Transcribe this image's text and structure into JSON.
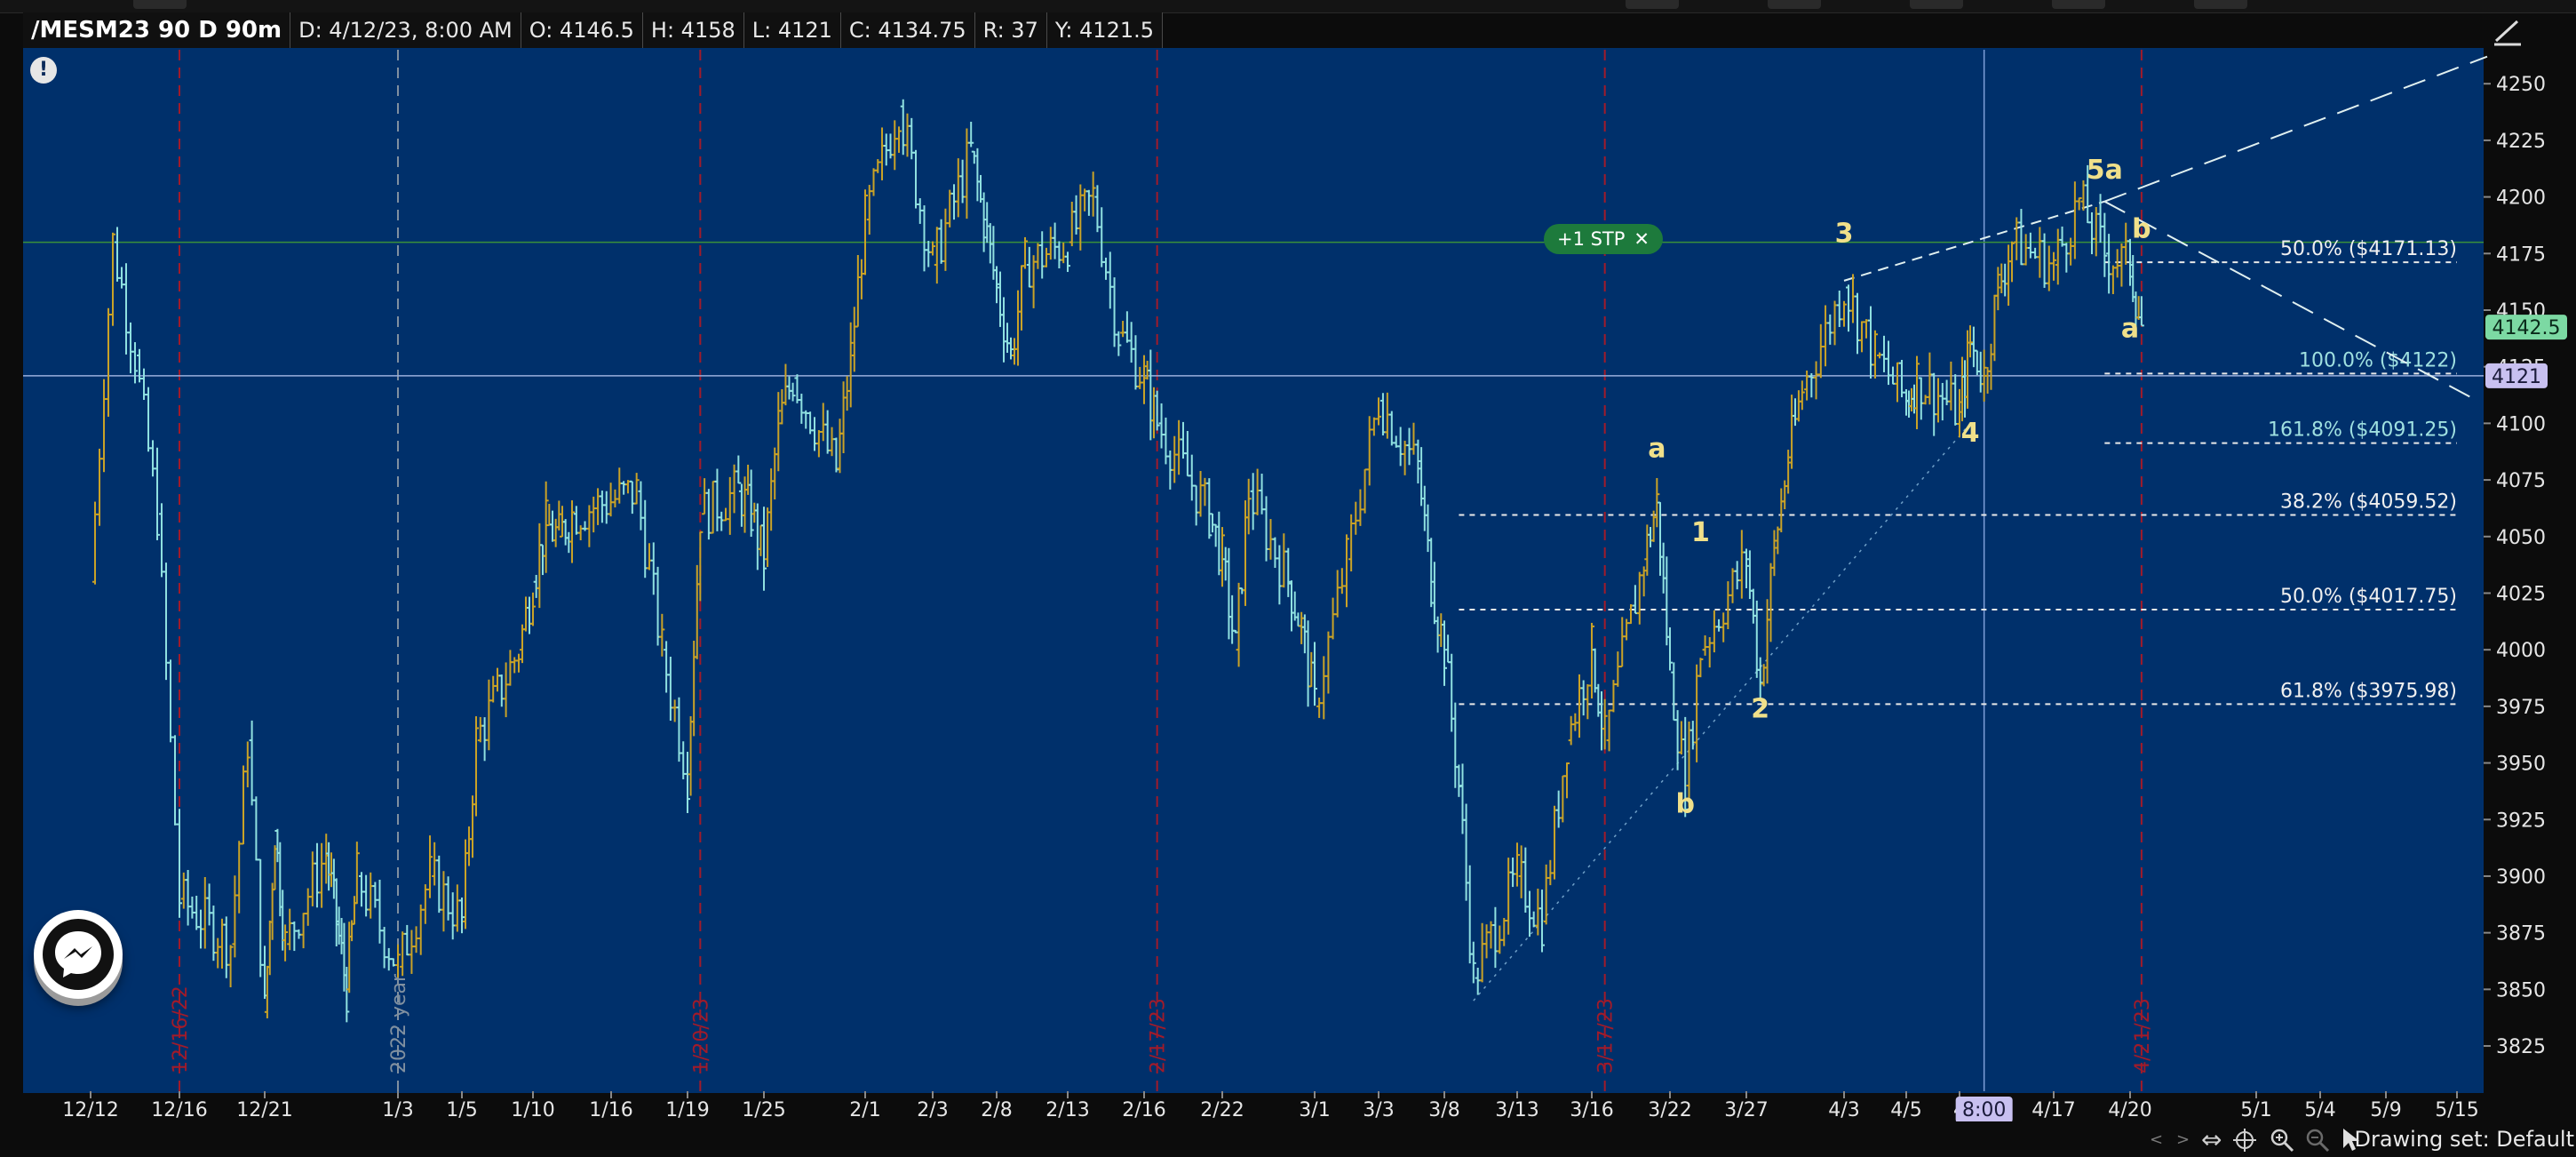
{
  "header": {
    "symbol": "/MESM23 90 D 90m",
    "date": "D: 4/12/23, 8:00 AM",
    "open": "O: 4146.5",
    "high": "H: 4158",
    "low": "L: 4121",
    "close": "C: 4134.75",
    "range": "R: 37",
    "y": "Y: 4121.5"
  },
  "order_badge": {
    "label": "+1 STP",
    "close_glyph": "✕"
  },
  "alert_glyph": "!",
  "drawing_set": "Drawing set: Default",
  "icons": {
    "alert": "exclamation-icon",
    "messenger": "messenger-icon",
    "order_close": "close-icon",
    "crosshair": "crosshair-icon",
    "zoom_in": "zoom-in-icon",
    "zoom_out": "zoom-out-icon",
    "cursor": "cursor-icon",
    "pan": "pan-arrows-icon",
    "drawing_tool": "trendline-tool-icon"
  },
  "colors": {
    "plot_bg": "#00306b",
    "up_bar": "#c9a227",
    "down_bar": "#8fe0e0",
    "axis_text": "#e6e6e6",
    "vertical_event_line": "#a11b2a",
    "price_label_green": "#7cd9a3",
    "price_label_purple": "#c8c0f0",
    "stp_green": "#1d7a3c",
    "wave_label": "#f0e08a"
  },
  "chart_data": {
    "type": "ohlc",
    "symbol": "/MESM23",
    "interval": "90m",
    "range_days": 90,
    "ylim": [
      3805,
      4265
    ],
    "y_ticks": [
      3825,
      3850,
      3875,
      3900,
      3925,
      3950,
      3975,
      4000,
      4025,
      4050,
      4075,
      4100,
      4125,
      4150,
      4175,
      4200,
      4225,
      4250
    ],
    "x_ticks": [
      "12/12",
      "12/16",
      "12/21",
      "1/3",
      "1/5",
      "1/10",
      "1/16",
      "1/19",
      "1/25",
      "2/1",
      "2/3",
      "2/8",
      "2/13",
      "2/16",
      "2/22",
      "3/1",
      "3/3",
      "3/8",
      "3/13",
      "3/16",
      "3/22",
      "3/27",
      "4/3",
      "4/5",
      "4",
      "4/17",
      "4/20",
      "5/1",
      "5/4",
      "5/9",
      "5/15"
    ],
    "x_cursor_label": "8:00",
    "price_path": [
      [
        "12/12",
        4030
      ],
      [
        "12/13",
        4180
      ],
      [
        "12/14",
        4130
      ],
      [
        "12/15",
        4060
      ],
      [
        "12/16",
        3890
      ],
      [
        "12/19",
        3870
      ],
      [
        "12/20",
        3960
      ],
      [
        "12/21",
        3840
      ],
      [
        "12/22",
        3920
      ],
      [
        "12/23",
        3870
      ],
      [
        "12/27",
        3910
      ],
      [
        "12/28",
        3880
      ],
      [
        "12/29",
        3850
      ],
      [
        "12/30",
        3900
      ],
      [
        "1/3",
        3860
      ],
      [
        "1/4",
        3900
      ],
      [
        "1/5",
        3880
      ],
      [
        "1/6",
        3960
      ],
      [
        "1/9",
        4000
      ],
      [
        "1/10",
        4030
      ],
      [
        "1/11",
        4055
      ],
      [
        "1/12",
        4050
      ],
      [
        "1/13",
        4060
      ],
      [
        "1/17",
        4070
      ],
      [
        "1/18",
        4000
      ],
      [
        "1/19",
        3945
      ],
      [
        "1/20",
        4060
      ],
      [
        "1/23",
        4070
      ],
      [
        "1/24",
        4060
      ],
      [
        "1/25",
        4040
      ],
      [
        "1/26",
        4100
      ],
      [
        "1/27",
        4120
      ],
      [
        "1/30",
        4080
      ],
      [
        "1/31",
        4130
      ],
      [
        "2/1",
        4190
      ],
      [
        "2/2",
        4240
      ],
      [
        "2/3",
        4170
      ],
      [
        "2/6",
        4220
      ],
      [
        "2/7",
        4190
      ],
      [
        "2/8",
        4160
      ],
      [
        "2/9",
        4130
      ],
      [
        "2/10",
        4170
      ],
      [
        "2/13",
        4180
      ],
      [
        "2/14",
        4200
      ],
      [
        "2/15",
        4140
      ],
      [
        "2/16",
        4120
      ],
      [
        "2/17",
        4100
      ],
      [
        "2/21",
        4060
      ],
      [
        "2/22",
        4040
      ],
      [
        "2/23",
        4000
      ],
      [
        "2/24",
        4070
      ],
      [
        "2/27",
        4030
      ],
      [
        "2/28",
        4010
      ],
      [
        "3/1",
        3975
      ],
      [
        "3/2",
        4040
      ],
      [
        "3/3",
        4110
      ],
      [
        "3/6",
        4080
      ],
      [
        "3/7",
        4030
      ],
      [
        "3/8",
        4000
      ],
      [
        "3/9",
        3940
      ],
      [
        "3/10",
        3855
      ],
      [
        "3/13",
        3900
      ],
      [
        "3/14",
        3880
      ],
      [
        "3/15",
        3960
      ],
      [
        "3/16",
        4000
      ],
      [
        "3/17",
        3960
      ],
      [
        "3/20",
        4040
      ],
      [
        "3/21",
        4065
      ],
      [
        "3/22",
        3990
      ],
      [
        "3/23",
        3940
      ],
      [
        "3/24",
        4000
      ],
      [
        "3/27",
        4040
      ],
      [
        "3/28",
        3985
      ],
      [
        "3/29",
        4045
      ],
      [
        "3/30",
        4085
      ],
      [
        "3/31",
        4115
      ],
      [
        "4/3",
        4160
      ],
      [
        "4/4",
        4130
      ],
      [
        "4/5",
        4110
      ],
      [
        "4/6",
        4120
      ],
      [
        "4/10",
        4105
      ],
      [
        "4/11",
        4135
      ],
      [
        "4/12",
        4121
      ],
      [
        "4/13",
        4160
      ],
      [
        "4/14",
        4180
      ],
      [
        "4/17",
        4170
      ],
      [
        "4/18",
        4198
      ],
      [
        "4/19",
        4175
      ],
      [
        "4/20",
        4170
      ],
      [
        "4/21",
        4142.5
      ]
    ],
    "last_price": "4142.5",
    "cursor_price": "4121",
    "cursor_date": "4/12",
    "fib_levels": [
      {
        "label": "50.0%  ($4171.13)",
        "price": 4171.13,
        "from": "4/19",
        "to": "5/15"
      },
      {
        "label": "100.0%  ($4122)",
        "price": 4122,
        "from": "4/19",
        "to": "5/15"
      },
      {
        "label": "161.8%  ($4091.25)",
        "price": 4091.25,
        "from": "4/19",
        "to": "5/15"
      },
      {
        "label": "38.2%  ($4059.52)",
        "price": 4059.52,
        "from": "3/9",
        "to": "5/15"
      },
      {
        "label": "50.0%  ($4017.75)",
        "price": 4017.75,
        "from": "3/9",
        "to": "5/15"
      },
      {
        "label": "61.8%  ($3975.98)",
        "price": 3975.98,
        "from": "3/9",
        "to": "5/15"
      }
    ],
    "horizontal_lines": [
      {
        "price": 4180,
        "color": "#3a8f3a"
      },
      {
        "price": 4121,
        "color": "#9aaedc"
      }
    ],
    "vertical_markers": [
      {
        "date": "12/16",
        "label": "12/16/22",
        "style": "red"
      },
      {
        "date": "1/3",
        "label": "2022 year",
        "style": "gray"
      },
      {
        "date": "1/20",
        "label": "1/20/23",
        "style": "red"
      },
      {
        "date": "2/17",
        "label": "2/17/23",
        "style": "red"
      },
      {
        "date": "3/17",
        "label": "3/17/23",
        "style": "red"
      },
      {
        "date": "4/21",
        "label": "4/21/23",
        "style": "red"
      }
    ],
    "cursor_vertical_date": "4/12",
    "wave_labels": [
      {
        "text": "a",
        "date": "3/21",
        "price": 4085
      },
      {
        "text": "b",
        "date": "3/23",
        "price": 3928
      },
      {
        "text": "1",
        "date": "3/24",
        "price": 4048
      },
      {
        "text": "2",
        "date": "3/28",
        "price": 3970
      },
      {
        "text": "3",
        "date": "4/3",
        "price": 4180
      },
      {
        "text": "4",
        "date": "4/11",
        "price": 4092
      },
      {
        "text": "5a",
        "date": "4/19",
        "price": 4208
      },
      {
        "text": "b",
        "date": "4/21",
        "price": 4182
      },
      {
        "text": "a",
        "date": "4/20",
        "price": 4138
      }
    ],
    "trendlines": [
      {
        "from": [
          "4/3",
          4163
        ],
        "to": [
          "4/19",
          4198
        ],
        "style": "dashed"
      },
      {
        "from": [
          "4/19",
          4198
        ],
        "to": [
          "5/18",
          4262
        ],
        "style": "long-dash"
      },
      {
        "from": [
          "4/19",
          4198
        ],
        "to": [
          "5/17",
          4110
        ],
        "style": "long-dash"
      },
      {
        "from": [
          "3/10",
          3845
        ],
        "to": [
          "4/11",
          4100
        ],
        "style": "dotted"
      }
    ]
  }
}
